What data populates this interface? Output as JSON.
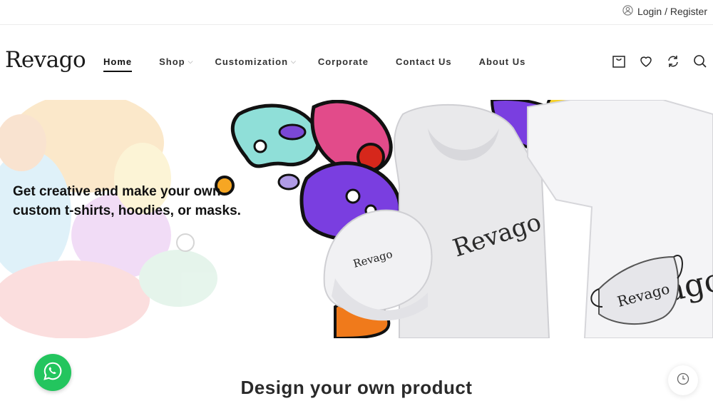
{
  "topbar": {
    "login_label": "Login / Register",
    "user_icon": "user-icon"
  },
  "header": {
    "logo": "Revago",
    "nav": [
      {
        "label": "Home",
        "active": true
      },
      {
        "label": "Shop",
        "dropdown": true
      },
      {
        "label": "Customization",
        "dropdown": true
      },
      {
        "label": "Corporate"
      },
      {
        "label": "Contact Us"
      },
      {
        "label": "About Us"
      }
    ],
    "icons": [
      "cart-icon",
      "heart-icon",
      "compare-icon",
      "search-icon"
    ]
  },
  "hero": {
    "line1": "Get creative and make your own",
    "line2": "custom t-shirts, hoodies, or masks.",
    "brand_print": "Revago"
  },
  "section": {
    "title": "Design your own product"
  },
  "widgets": {
    "whatsapp_icon": "whatsapp-icon",
    "history_icon": "clock-icon"
  },
  "colors": {
    "whatsapp": "#23c55e",
    "accent_dark": "#111111"
  }
}
